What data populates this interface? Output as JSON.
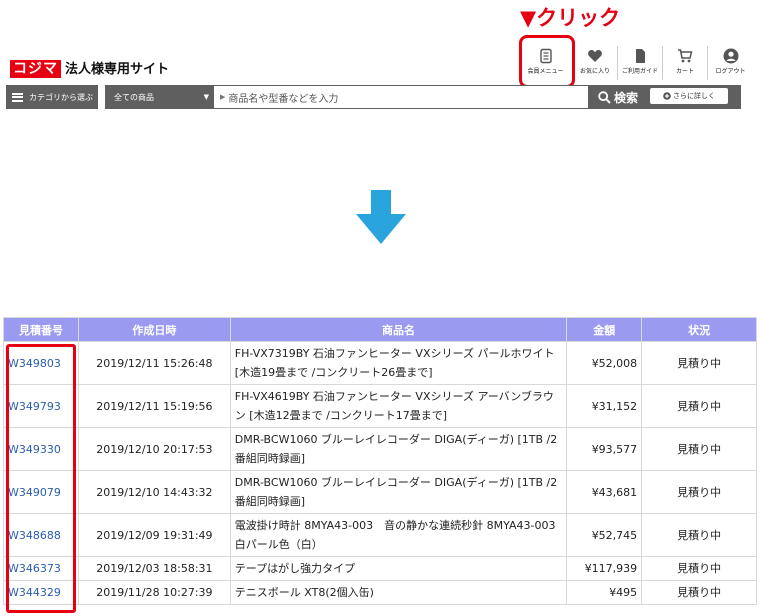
{
  "annotation": {
    "click_label": "▼クリック"
  },
  "header": {
    "brand": "コジマ",
    "subtitle": "法人様専用サイト",
    "nav": [
      {
        "label": "会員メニュー",
        "icon": "member-menu-icon"
      },
      {
        "label": "お気に入り",
        "icon": "heart-icon"
      },
      {
        "label": "ご利用ガイド",
        "icon": "guide-icon"
      },
      {
        "label": "カート",
        "icon": "cart-icon"
      },
      {
        "label": "ログアウト",
        "icon": "user-icon"
      }
    ]
  },
  "search": {
    "category_button": "カテゴリから選ぶ",
    "scope": "全ての商品",
    "placeholder": "商品名や型番などを入力",
    "search_button": "検索",
    "detail_button": "さらに詳しく"
  },
  "colors": {
    "accent_red": "#e60012",
    "header_purple": "#9a9bf0",
    "arrow_blue": "#29a4dc",
    "bar_gray": "#5f5f5f"
  },
  "table": {
    "headers": [
      "見積番号",
      "作成日時",
      "商品名",
      "金額",
      "状況"
    ],
    "rows": [
      {
        "no": "W349803",
        "date": "2019/12/11 15:26:48",
        "name": "FH-VX7319BY 石油ファンヒーター VXシリーズ パールホワイト [木造19畳まで /コンクリート26畳まで]",
        "amount": "¥52,008",
        "status": "見積り中"
      },
      {
        "no": "W349793",
        "date": "2019/12/11 15:19:56",
        "name": "FH-VX4619BY 石油ファンヒーター VXシリーズ アーバンブラウン [木造12畳まで /コンクリート17畳まで]",
        "amount": "¥31,152",
        "status": "見積り中"
      },
      {
        "no": "W349330",
        "date": "2019/12/10 20:17:53",
        "name": "DMR-BCW1060 ブルーレイレコーダー DIGA(ディーガ) [1TB /2番組同時録画]",
        "amount": "¥93,577",
        "status": "見積り中"
      },
      {
        "no": "W349079",
        "date": "2019/12/10 14:43:32",
        "name": "DMR-BCW1060 ブルーレイレコーダー DIGA(ディーガ) [1TB /2番組同時録画]",
        "amount": "¥43,681",
        "status": "見積り中"
      },
      {
        "no": "W348688",
        "date": "2019/12/09 19:31:49",
        "name": "電波掛け時計 8MYA43-003　音の静かな連続秒針 8MYA43-003 白パール色（白）",
        "amount": "¥52,745",
        "status": "見積り中"
      },
      {
        "no": "W346373",
        "date": "2019/12/03 18:58:31",
        "name": "テープはがし強力タイプ",
        "amount": "¥117,939",
        "status": "見積り中"
      },
      {
        "no": "W344329",
        "date": "2019/11/28 10:27:39",
        "name": "テニスボール XT8(2個入缶)",
        "amount": "¥495",
        "status": "見積り中"
      }
    ]
  }
}
